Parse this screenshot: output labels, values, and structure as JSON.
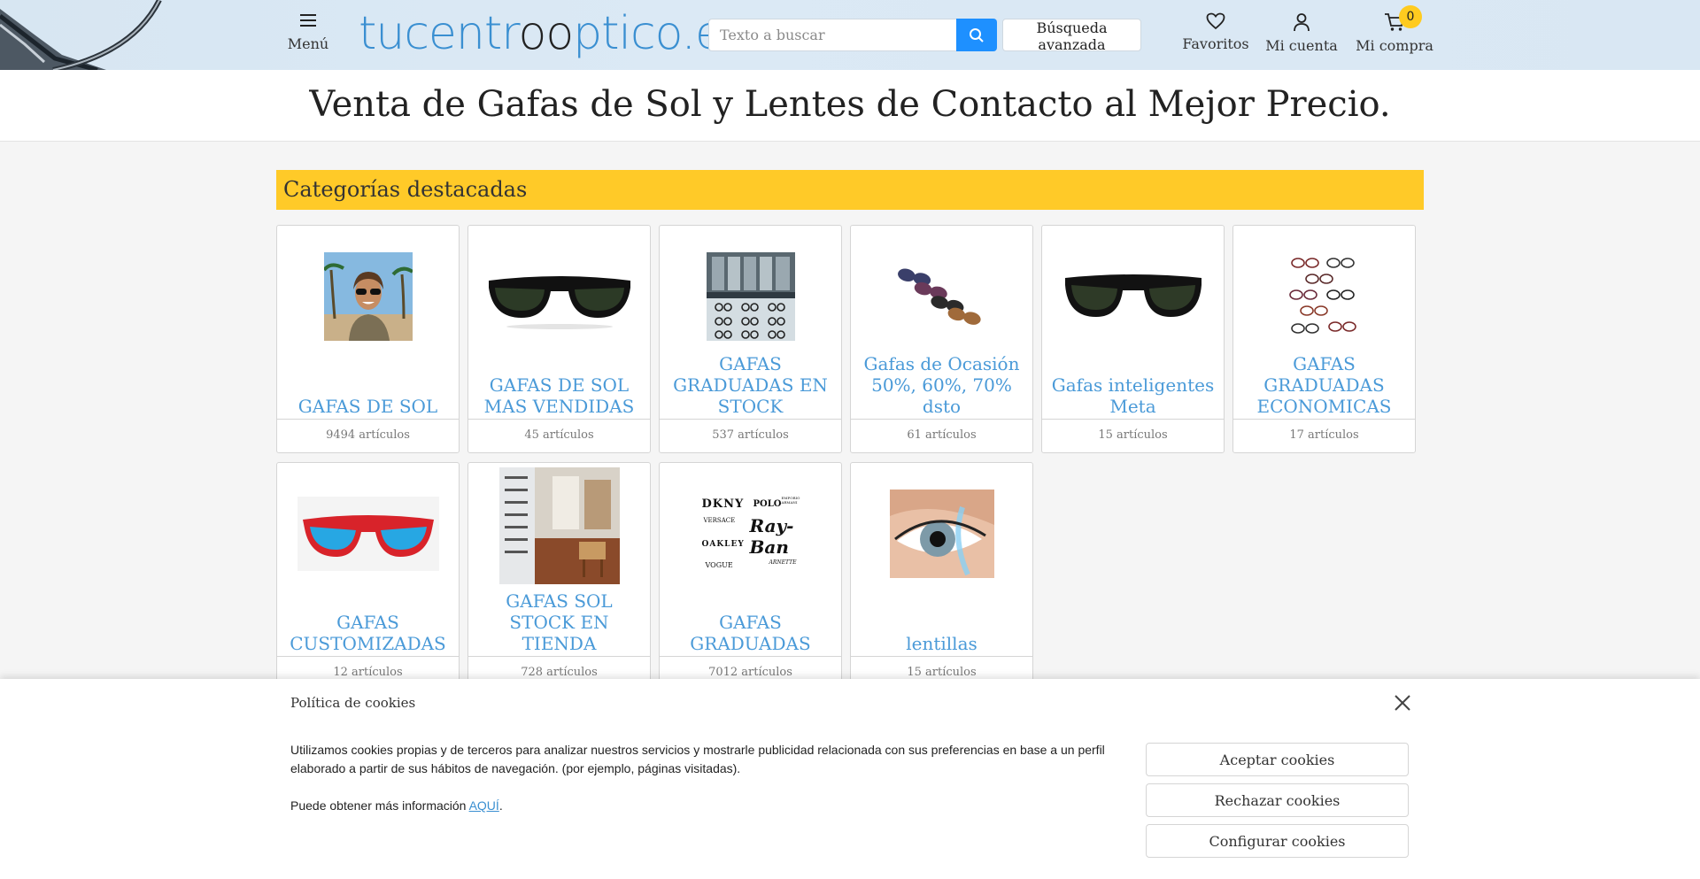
{
  "header": {
    "menu_label": "Menú",
    "logo_pre": "tucentr",
    "logo_oo": "oo",
    "logo_post": "ptico.es",
    "search_placeholder": "Texto a buscar",
    "advanced_search_label": "Búsqueda avanzada",
    "favorites_label": "Favoritos",
    "account_label": "Mi cuenta",
    "cart_label": "Mi compra",
    "cart_count": "0",
    "icons": [
      "menu-icon",
      "search-icon",
      "heart-icon",
      "user-icon",
      "cart-icon"
    ]
  },
  "tagline": "Venta de Gafas de Sol y Lentes de Contacto al Mejor Precio.",
  "categories": {
    "title": "Categorías destacadas",
    "items": [
      {
        "name": "GAFAS DE SOL",
        "count": "9494 artículos"
      },
      {
        "name": "GAFAS DE SOL MAS VENDIDAS",
        "count": "45 artículos"
      },
      {
        "name": "GAFAS GRADUADAS EN STOCK",
        "count": "537 artículos"
      },
      {
        "name": "Gafas de Ocasión 50%, 60%, 70% dsto",
        "count": "61 artículos"
      },
      {
        "name": "Gafas inteligentes Meta",
        "count": "15 artículos"
      },
      {
        "name": "GAFAS GRADUADAS ECONOMICAS",
        "count": "17 artículos"
      },
      {
        "name": "GAFAS CUSTOMIZADAS",
        "count": "12 artículos"
      },
      {
        "name": "GAFAS SOL STOCK EN TIENDA",
        "count": "728 artículos"
      },
      {
        "name": "GAFAS GRADUADAS",
        "count": "7012 artículos"
      },
      {
        "name": "lentillas",
        "count": "15 artículos"
      }
    ]
  },
  "brands": {
    "dkny": "DKNY",
    "polo": "POLO",
    "emporio": "EMPORIO ARMANI",
    "versace": "VERSACE",
    "rayban": "Ray-Ban",
    "oakley": "OAKLEY",
    "vogue": "VOGUE",
    "arnette": "ARNETTE"
  },
  "cookies": {
    "title": "Política de cookies",
    "text": "Utilizamos cookies propias y de terceros para analizar nuestros servicios y mostrarle publicidad relacionada con sus preferencias en base a un perfil elaborado a partir de sus hábitos de navegación. (por ejemplo, páginas visitadas).",
    "more_prefix": "Puede obtener más información ",
    "more_link": "AQUÍ",
    "more_suffix": ".",
    "accept_label": "Aceptar cookies",
    "reject_label": "Rechazar cookies",
    "configure_label": "Configurar cookies"
  },
  "colors": {
    "brand_blue": "#3a8fd1",
    "search_button": "#1e90ff",
    "category_bar": "#ffca28",
    "badge": "#ffcb1f"
  }
}
